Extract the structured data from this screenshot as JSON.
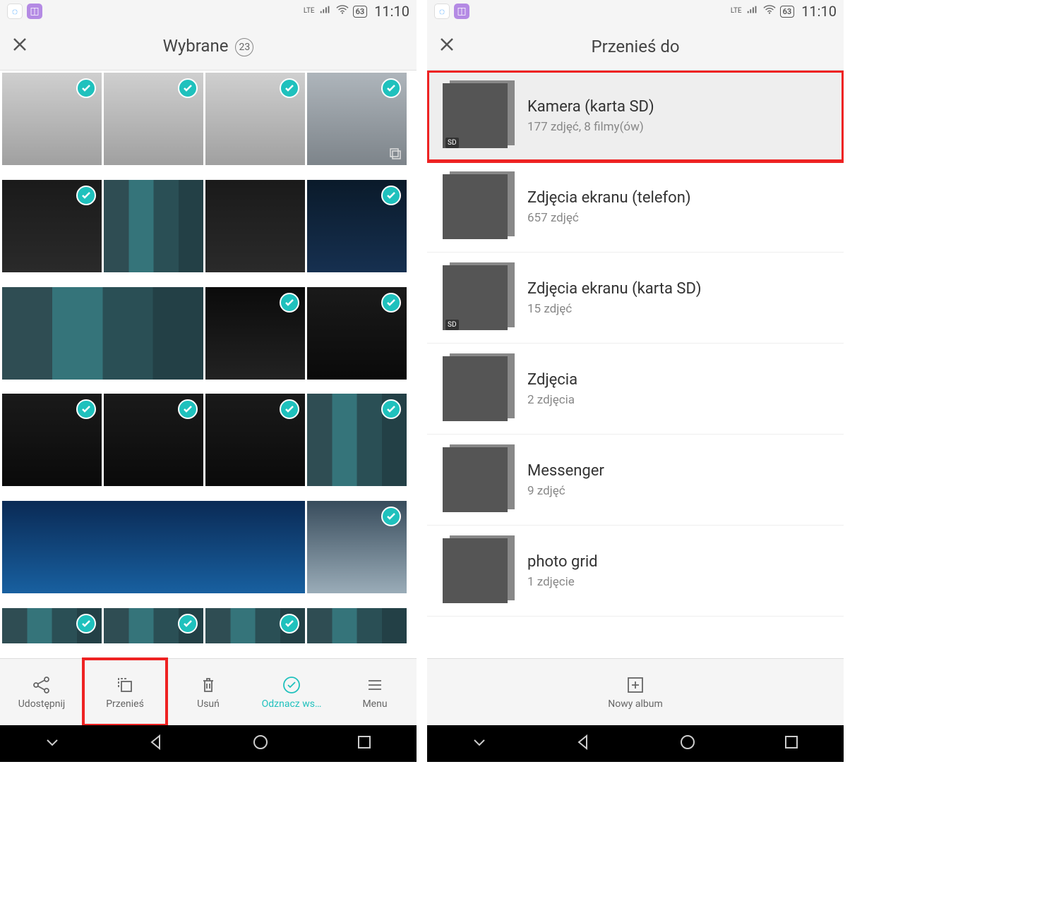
{
  "status": {
    "lte": "LTE",
    "battery": "63",
    "time": "11:10"
  },
  "left": {
    "title": "Wybrane",
    "count": "23",
    "bottom": {
      "share": "Udostępnij",
      "move": "Przenieś",
      "delete": "Usuń",
      "deselect": "Odznacz ws…",
      "menu": "Menu"
    }
  },
  "right": {
    "title": "Przenieś do",
    "albums": [
      {
        "title": "Kamera (karta SD)",
        "sub": "177 zdjęć,  8 filmy(ów)",
        "sd": true,
        "highlight": true,
        "thumbClass": "p-doc"
      },
      {
        "title": "Zdjęcia ekranu (telefon)",
        "sub": "657 zdjęć",
        "thumbClass": "p-pixelated"
      },
      {
        "title": "Zdjęcia ekranu (karta SD)",
        "sub": "15 zdjęć",
        "sd": true,
        "thumbClass": "p-textscreen"
      },
      {
        "title": "Zdjęcia",
        "sub": "2 zdjęcia",
        "thumbClass": "p-purple"
      },
      {
        "title": "Messenger",
        "sub": "9 zdjęć",
        "thumbClass": "p-device"
      },
      {
        "title": "photo grid",
        "sub": "1 zdjęcie",
        "thumbClass": "p-photogrid"
      }
    ],
    "new_album": "Nowy album",
    "sd_label": "SD"
  },
  "thumbs": [
    {
      "cls": "p-controller"
    },
    {
      "cls": "p-controller"
    },
    {
      "cls": "p-controller"
    },
    {
      "cls": "p-city",
      "stack": true
    },
    {
      "cls": "p-keyboard"
    },
    {
      "cls": "p-pixelated",
      "check": false
    },
    {
      "cls": "p-keyboard",
      "check": false
    },
    {
      "cls": "p-masseffect"
    },
    {
      "cls": "p-pixelated",
      "wide": true,
      "check": false
    },
    {
      "cls": "p-ctrl"
    },
    {
      "cls": "p-dark"
    },
    {
      "cls": "p-dark"
    },
    {
      "cls": "p-dark"
    },
    {
      "cls": "p-dark"
    },
    {
      "cls": "p-pixelated"
    },
    {
      "cls": "p-blue",
      "wider": true,
      "check": false
    },
    {
      "cls": "p-window"
    },
    {
      "cls": "p-pixelated",
      "short": true
    },
    {
      "cls": "p-pixelated",
      "short": true
    },
    {
      "cls": "p-pixelated",
      "short": true
    },
    {
      "cls": "p-pixelated",
      "short": true,
      "check": false
    }
  ]
}
